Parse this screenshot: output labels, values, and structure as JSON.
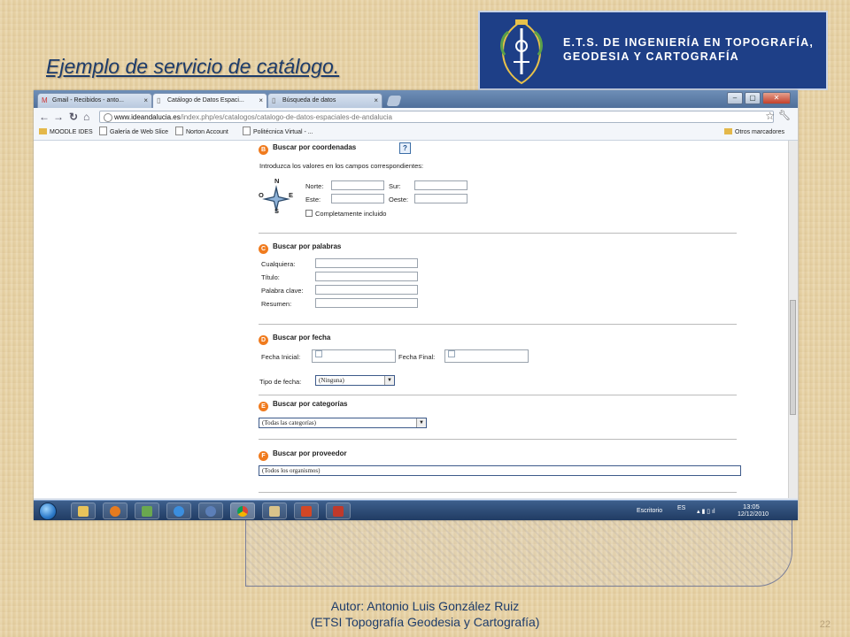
{
  "slide": {
    "title": "Ejemplo de servicio de catálogo.",
    "logo_line1": "E.T.S. DE INGENIERÍA EN TOPOGRAFÍA,",
    "logo_line2": "GEODESIA Y CARTOGRAFÍA",
    "footer_line1": "Autor:  Antonio Luis González Ruiz",
    "footer_line2": "(ETSI Topografía Geodesia y Cartografía)",
    "page_number": "22"
  },
  "browser": {
    "tabs": [
      {
        "label": "Gmail - Recibidos - anto...",
        "icon": "gmail-icon"
      },
      {
        "label": "Catálogo de Datos Espaci...",
        "icon": "page-icon"
      },
      {
        "label": "Búsqueda de datos",
        "icon": "page-icon"
      }
    ],
    "url_host": "www.ideandalucia.es",
    "url_path": "/index.php/es/catalogos/catalogo-de-datos-espaciales-de-andalucia",
    "bookmarks": [
      "MOODLE IDES",
      "Galería de Web Slice",
      "Norton Account",
      "Politécnica Virtual - ..."
    ],
    "other_bookmarks": "Otros marcadores"
  },
  "form": {
    "coords": {
      "badge": "B",
      "title": "Buscar por coordenadas",
      "hint": "Introduzca los valores en los campos correspondientes:",
      "norte": "Norte:",
      "sur": "Sur:",
      "este": "Este:",
      "oeste": "Oeste:",
      "included": "Completamente incluido",
      "compass_n": "N",
      "compass_s": "S",
      "compass_e": "E",
      "compass_o": "O"
    },
    "words": {
      "badge": "C",
      "title": "Buscar por palabras",
      "cualquiera": "Cualquiera:",
      "titulo": "Título:",
      "palabra": "Palabra clave:",
      "resumen": "Resumen:"
    },
    "date": {
      "badge": "D",
      "title": "Buscar por fecha",
      "inicial": "Fecha Inicial:",
      "final": "Fecha Final:",
      "tipo": "Tipo de fecha:",
      "tipo_value": "(Ninguna)"
    },
    "categories": {
      "badge": "E",
      "title": "Buscar por categorías",
      "value": "(Todas las categorías)"
    },
    "provider": {
      "badge": "F",
      "title": "Buscar por proveedor",
      "value": "(Todos los organismos)"
    }
  },
  "taskbar": {
    "escritorio": "Escritorio",
    "lang": "ES",
    "time": "13:05",
    "date": "12/12/2010"
  }
}
